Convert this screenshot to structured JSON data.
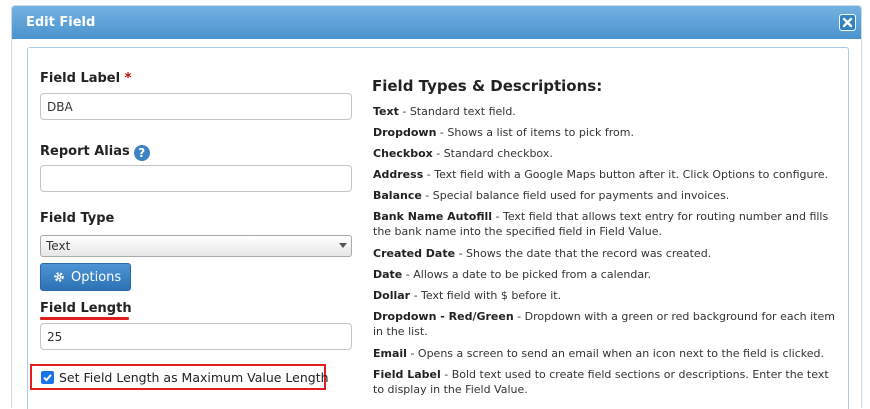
{
  "dialog": {
    "title": "Edit Field",
    "close_icon": "close-icon"
  },
  "form": {
    "field_label": {
      "label": "Field Label",
      "required_mark": "*",
      "value": "DBA"
    },
    "report_alias": {
      "label": "Report Alias",
      "help_icon": "?",
      "value": ""
    },
    "field_type": {
      "label": "Field Type",
      "selected": "Text"
    },
    "options_button": {
      "label": "Options",
      "icon": "gear-icon"
    },
    "field_length": {
      "label": "Field Length",
      "value": "25"
    },
    "max_length_checkbox": {
      "label": "Set Field Length as Maximum Value Length",
      "checked": true
    }
  },
  "types": {
    "heading": "Field Types & Descriptions:",
    "items": [
      {
        "name": "Text",
        "desc": " - Standard text field."
      },
      {
        "name": "Dropdown",
        "desc": " - Shows a list of items to pick from."
      },
      {
        "name": "Checkbox",
        "desc": " - Standard checkbox."
      },
      {
        "name": "Address",
        "desc": " - Text field with a Google Maps button after it. Click Options to configure."
      },
      {
        "name": "Balance",
        "desc": " - Special balance field used for payments and invoices."
      },
      {
        "name": "Bank Name Autofill",
        "desc": " - Text field that allows text entry for routing number and fills the bank name into the specified field in Field Value."
      },
      {
        "name": "Created Date",
        "desc": " - Shows the date that the record was created."
      },
      {
        "name": "Date",
        "desc": " - Allows a date to be picked from a calendar."
      },
      {
        "name": "Dollar",
        "desc": " - Text field with $ before it."
      },
      {
        "name": "Dropdown - Red/Green",
        "desc": " - Dropdown with a green or red background for each item in the list."
      },
      {
        "name": "Email",
        "desc": " - Opens a screen to send an email when an icon next to the field is clicked."
      },
      {
        "name": "Field Label",
        "desc": " - Bold text used to create field sections or descriptions. Enter the text to display in the Field Value."
      }
    ]
  },
  "colors": {
    "accent": "#4a93cd",
    "highlight": "#e01e1e",
    "button": "#2c73b5"
  }
}
